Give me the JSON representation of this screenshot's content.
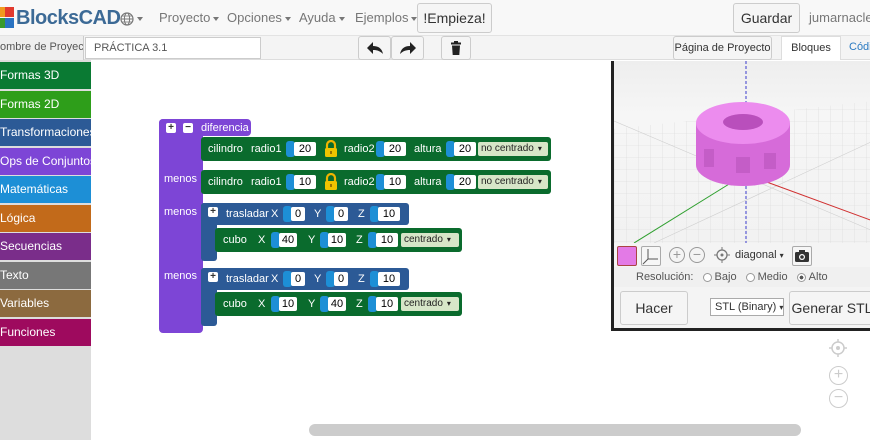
{
  "app": {
    "logo_text": "BlocksCAD"
  },
  "nav": {
    "menu_items": [
      "Proyecto",
      "Opciones",
      "Ayuda",
      "Ejemplos"
    ],
    "start_button": "!Empieza!",
    "save_button": "Guardar",
    "user": "jumarnacle"
  },
  "project": {
    "name_label": "ombre de Proyecto",
    "name_value": "PRÁCTICA 3.1",
    "page_button": "Página de Proyecto",
    "tab_blocks": "Bloques",
    "tab_code": "Códi"
  },
  "categories": [
    {
      "label": "Formas 3D",
      "color": "#0a7a33"
    },
    {
      "label": "Formas 2D",
      "color": "#2e9e1a"
    },
    {
      "label": "Transformaciones",
      "color": "#2c5a96"
    },
    {
      "label": "Ops de Conjuntos",
      "color": "#7d45d6"
    },
    {
      "label": "Matemáticas",
      "color": "#1d8fd6"
    },
    {
      "label": "Lógica",
      "color": "#c26a1a"
    },
    {
      "label": "Secuencias",
      "color": "#7a2d8a"
    },
    {
      "label": "Texto",
      "color": "#777777"
    },
    {
      "label": "Variables",
      "color": "#8c6a3f"
    },
    {
      "label": "Funciones",
      "color": "#9e0a5e"
    }
  ],
  "blocks": {
    "difference_label": "diferencia",
    "minus_label": "menos",
    "cyl": {
      "name": "cilindro",
      "r1_label": "radio1",
      "r2_label": "radio2",
      "h_label": "altura",
      "rows": [
        {
          "r1": "20",
          "r2": "20",
          "h": "20",
          "center": "no centrado"
        },
        {
          "r1": "10",
          "r2": "10",
          "h": "20",
          "center": "no centrado"
        }
      ]
    },
    "translate_label": "trasladar",
    "cube_label": "cubo",
    "x_label": "X",
    "y_label": "Y",
    "z_label": "Z",
    "t1": {
      "x": "0",
      "y": "0",
      "z": "10"
    },
    "c1": {
      "x": "40",
      "y": "10",
      "z": "10",
      "center": "centrado"
    },
    "t2": {
      "x": "0",
      "y": "0",
      "z": "10"
    },
    "c2": {
      "x": "10",
      "y": "40",
      "z": "10",
      "center": "centrado"
    }
  },
  "view3d": {
    "camera": "diagonal",
    "resolution_label": "Resolución:",
    "res_options": [
      "Bajo",
      "Medio",
      "Alto"
    ],
    "res_selected": "Alto",
    "render_button": "Hacer",
    "format_select": "STL (Binary)",
    "generate_button": "Generar STL",
    "model_color": "#e37ae6"
  },
  "colors": {
    "set_ops": "#7d45d6",
    "shapes_3d": "#0a6b2d",
    "transforms": "#2c5a96"
  }
}
